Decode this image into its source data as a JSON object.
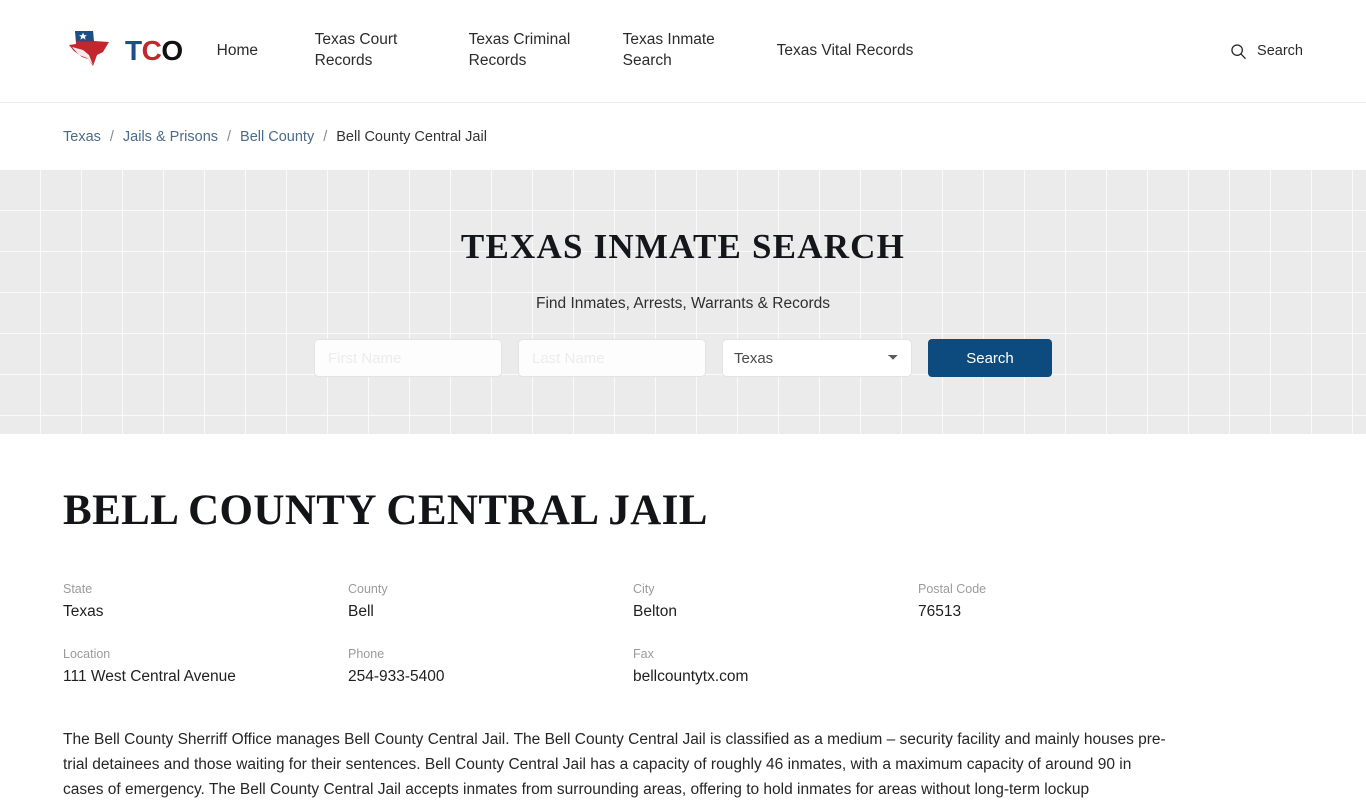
{
  "header": {
    "brand": {
      "icon": "texas-state-logo-icon",
      "letters": [
        {
          "char": "T",
          "color": "#1a4f87"
        },
        {
          "char": "C",
          "color": "#c1272d"
        },
        {
          "char": "O",
          "color": "#111111"
        }
      ]
    },
    "nav": [
      {
        "label": "Home",
        "name": "nav-home"
      },
      {
        "label": "Texas Court Records",
        "name": "nav-texas-court-records"
      },
      {
        "label": "Texas Criminal Records",
        "name": "nav-texas-criminal-records"
      },
      {
        "label": "Texas Inmate Search",
        "name": "nav-texas-inmate-search"
      },
      {
        "label": "Texas Vital Records",
        "name": "nav-texas-vital-records"
      }
    ],
    "search": {
      "icon": "search-icon",
      "label": "Search"
    }
  },
  "breadcrumb": {
    "separator": "/",
    "items": [
      {
        "label": "Texas",
        "current": false
      },
      {
        "label": "Jails & Prisons",
        "current": false
      },
      {
        "label": "Bell County",
        "current": false
      },
      {
        "label": "Bell County Central Jail",
        "current": true
      }
    ]
  },
  "hero": {
    "title": "TEXAS INMATE SEARCH",
    "subtitle": "Find Inmates, Arrests, Warrants & Records",
    "form": {
      "first_name": {
        "value": "",
        "placeholder": "First Name"
      },
      "last_name": {
        "value": "",
        "placeholder": "Last Name"
      },
      "state": {
        "selected": "Texas",
        "options": [
          "Texas"
        ]
      },
      "submit_label": "Search"
    },
    "background_color": "#ebebeb"
  },
  "main": {
    "title": "BELL COUNTY CENTRAL JAIL",
    "info": [
      {
        "label": "State",
        "value": "Texas"
      },
      {
        "label": "County",
        "value": "Bell"
      },
      {
        "label": "City",
        "value": "Belton"
      },
      {
        "label": "Postal Code",
        "value": "76513"
      },
      {
        "label": "Location",
        "value": "111 West Central Avenue"
      },
      {
        "label": "Phone",
        "value": "254-933-5400"
      },
      {
        "label": "Fax",
        "value": "bellcountytx.com"
      }
    ],
    "description": "The Bell County Sherriff Office manages Bell County Central Jail. The Bell County Central Jail is classified as a medium – security facility and mainly houses pre-trial detainees and those waiting for their sentences. Bell County Central Jail has a capacity of roughly 46 inmates, with a maximum capacity of around 90 in cases of emergency. The Bell County Central Jail accepts inmates from surrounding areas, offering to hold inmates for areas without long-term lockup"
  },
  "colors": {
    "accent_blue": "#0d4a7d",
    "brand_red": "#c1272d",
    "link": "#4a6b8a"
  }
}
